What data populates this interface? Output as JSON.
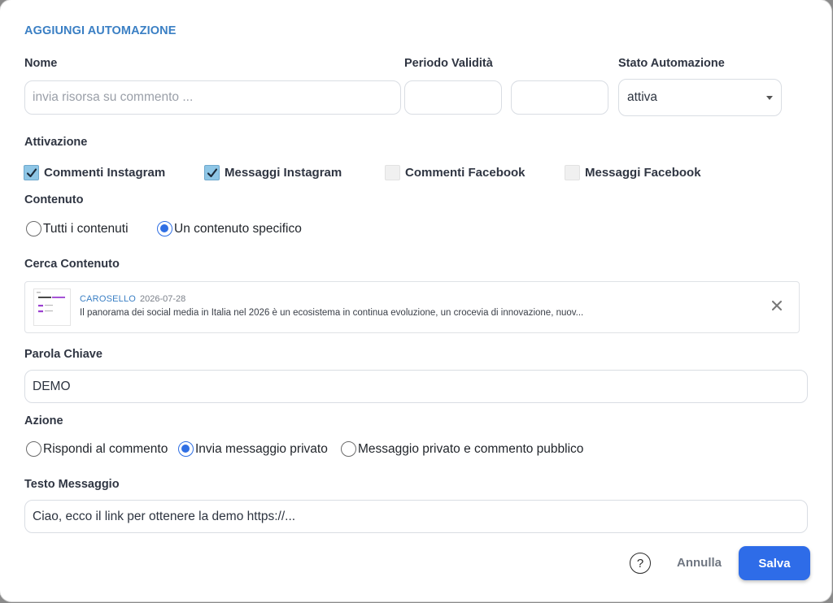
{
  "dialog": {
    "title": "AGGIUNGI AUTOMAZIONE"
  },
  "nome": {
    "label": "Nome",
    "placeholder": "invia risorsa su commento ...",
    "value": ""
  },
  "periodo": {
    "label": "Periodo Validità",
    "start": "",
    "end": ""
  },
  "stato": {
    "label": "Stato Automazione",
    "selected": "attiva"
  },
  "attivazione": {
    "label": "Attivazione",
    "options": [
      {
        "label": "Commenti Instagram",
        "checked": true
      },
      {
        "label": "Messaggi Instagram",
        "checked": true
      },
      {
        "label": "Commenti Facebook",
        "checked": false
      },
      {
        "label": "Messaggi Facebook",
        "checked": false
      }
    ]
  },
  "contenuto": {
    "label": "Contenuto",
    "options": [
      {
        "label": "Tutti i contenuti",
        "selected": false
      },
      {
        "label": "Un contenuto specifico",
        "selected": true
      }
    ]
  },
  "cerca": {
    "label": "Cerca Contenuto",
    "result": {
      "type": "CAROSELLO",
      "date": "2026-07-28",
      "description": "Il panorama dei social media in Italia nel 2026 è un ecosistema in continua evoluzione, un crocevia di innovazione, nuov..."
    }
  },
  "parola": {
    "label": "Parola Chiave",
    "value": "DEMO"
  },
  "azione": {
    "label": "Azione",
    "options": [
      {
        "label": "Rispondi al commento",
        "selected": false
      },
      {
        "label": "Invia messaggio privato",
        "selected": true
      },
      {
        "label": "Messaggio privato e commento pubblico",
        "selected": false
      }
    ]
  },
  "testo": {
    "label": "Testo Messaggio",
    "value": "Ciao, ecco il link per ottenere la demo https://..."
  },
  "footer": {
    "help": "?",
    "cancel": "Annulla",
    "save": "Salva"
  },
  "colors": {
    "accent": "#2e6ce8",
    "title": "#3a7fc4",
    "checkbox_on": "#8ec6e6"
  }
}
